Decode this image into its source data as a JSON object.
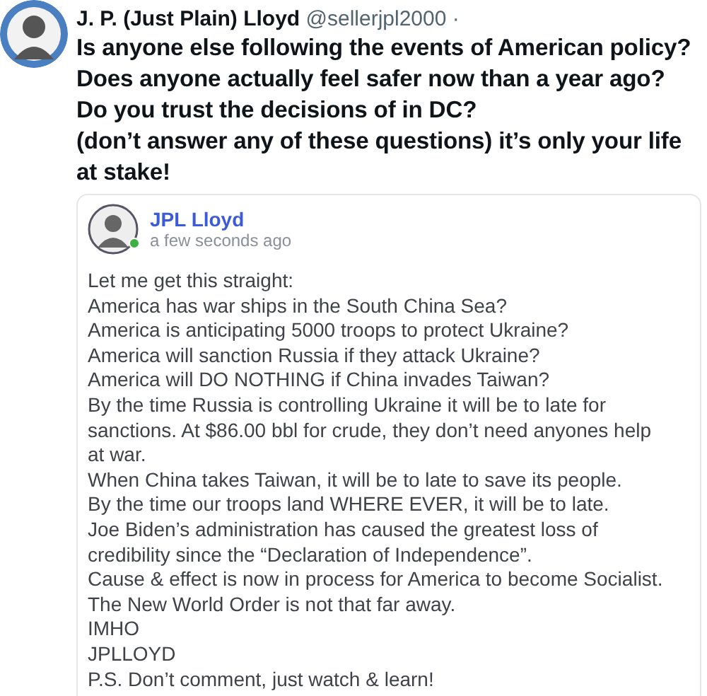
{
  "post": {
    "author": "J. P. (Just Plain) Lloyd",
    "handle": "@sellerjpl2000",
    "separator": "·",
    "lines": [
      "Is anyone else following the events of American policy?",
      "Does anyone actually feel safer now than a year ago?",
      "Do you trust the decisions of in DC?",
      "(don’t answer any of these questions) it’s only your life at stake!"
    ]
  },
  "shared_post": {
    "author": "JPL Lloyd",
    "online": true,
    "time": "a few seconds ago",
    "paragraphs": [
      "Let me get this straight:",
      "America has war ships in the South China Sea?",
      "America is anticipating 5000 troops to protect Ukraine?",
      "America will sanction Russia if they attack Ukraine?",
      "America will DO NOTHING if China invades Taiwan?",
      "By the time Russia is controlling Ukraine it will be to late for sanctions. At $86.00 bbl for crude, they don’t need anyones help at war.",
      "When China takes Taiwan, it will be to late to save its people.",
      "By the time our troops land WHERE EVER, it will be to late.",
      "Joe Biden’s administration has caused the greatest loss of credibility since the “Declaration of Independence”.",
      "Cause & effect is now in process for America to become Socialist.",
      "The New World Order is not that far away.",
      "IMHO",
      "JPLLOYD",
      "P.S. Don’t comment, just watch & learn!"
    ]
  }
}
